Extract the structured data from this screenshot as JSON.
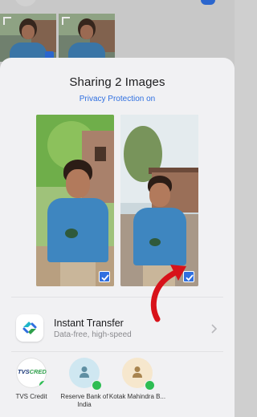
{
  "sheet": {
    "title": "Sharing 2 Images",
    "subtitle": "Privacy Protection on"
  },
  "instant_transfer": {
    "title": "Instant Transfer",
    "subtitle": "Data-free, high-speed",
    "icon": "transfer-icon"
  },
  "contacts": [
    {
      "label": "TVS Credit",
      "logo_text_main": "TVS",
      "logo_text_accent": "CREDIT",
      "badge": "whatsapp-icon"
    },
    {
      "label": "Reserve Bank of India",
      "badge": "whatsapp-icon",
      "icon": "person-icon"
    },
    {
      "label": "Kotak Mahindra B...",
      "badge": "whatsapp-icon",
      "icon": "person-icon"
    }
  ],
  "colors": {
    "accent": "#2f6fe0",
    "whatsapp": "#2ebd53",
    "annotation_arrow": "#d8121a"
  }
}
